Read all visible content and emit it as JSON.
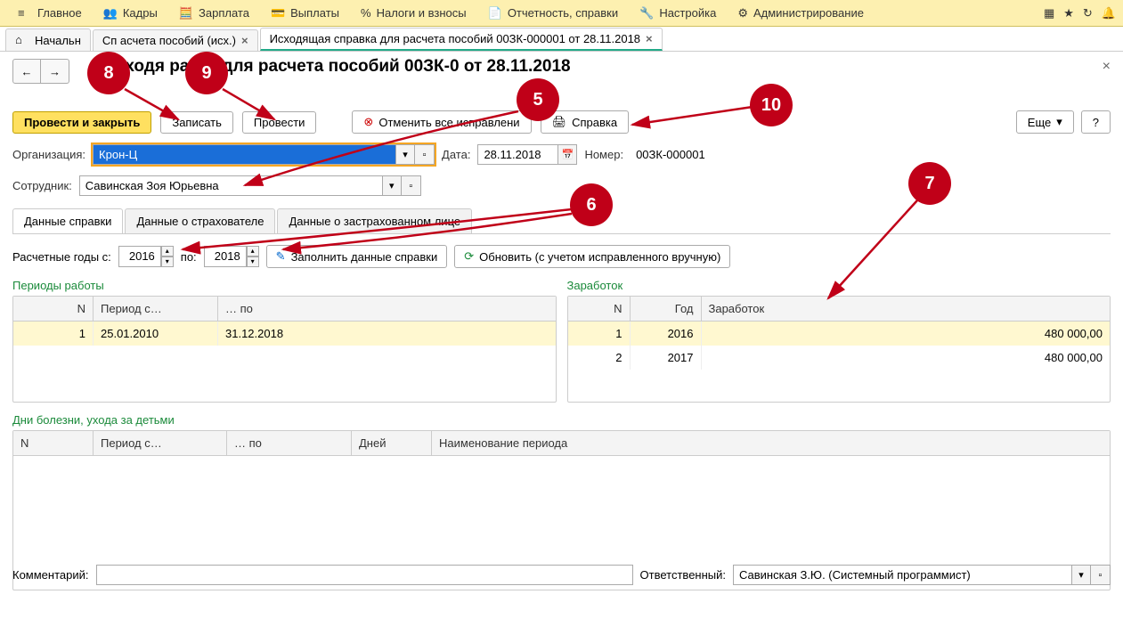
{
  "topbar": {
    "items": [
      {
        "label": "Главное"
      },
      {
        "label": "Кадры"
      },
      {
        "label": "Зарплата"
      },
      {
        "label": "Выплаты"
      },
      {
        "label": "Налоги и взносы"
      },
      {
        "label": "Отчетность, справки"
      },
      {
        "label": "Настройка"
      },
      {
        "label": "Администрирование"
      }
    ]
  },
  "tabs": {
    "t0": "Начальн",
    "t1": "Сп                 асчета пособий (исх.)",
    "t2": "Исходящая справка для расчета пособий 00ЗК-000001 от 28.11.2018"
  },
  "page_title": "сходя           равка для расчета пособий 00ЗК-0             от 28.11.2018",
  "toolbar": {
    "post_close": "Провести и закрыть",
    "write": "Записать",
    "post": "Провести",
    "cancel_fix": "Отменить все исправлени",
    "help": "Справка",
    "more": "Еще",
    "q": "?"
  },
  "form": {
    "org_label": "Организация:",
    "org_value": "Крон-Ц",
    "date_label": "Дата:",
    "date_value": "28.11.2018",
    "num_label": "Номер:",
    "num_value": "00ЗК-000001",
    "emp_label": "Сотрудник:",
    "emp_value": "Савинская Зоя Юрьевна"
  },
  "inner_tabs": {
    "a": "Данные справки",
    "b": "Данные о страхователе",
    "c": "Данные о застрахованном лице"
  },
  "years": {
    "label": "Расчетные годы с:",
    "from": "2016",
    "to_label": "по:",
    "to": "2018",
    "fill": "Заполнить данные справки",
    "refresh": "Обновить (с учетом исправленного вручную)"
  },
  "sections": {
    "periods": "Периоды работы",
    "earn": "Заработок",
    "sick": "Дни болезни, ухода за детьми"
  },
  "periods_table": {
    "h_n": "N",
    "h_from": "Период с…",
    "h_to": "… по",
    "rows": [
      {
        "n": "1",
        "from": "25.01.2010",
        "to": "31.12.2018"
      }
    ]
  },
  "earn_table": {
    "h_n": "N",
    "h_y": "Год",
    "h_e": "Заработок",
    "rows": [
      {
        "n": "1",
        "y": "2016",
        "e": "480 000,00"
      },
      {
        "n": "2",
        "y": "2017",
        "e": "480 000,00"
      }
    ]
  },
  "sick_table": {
    "h_n": "N",
    "h_from": "Период с…",
    "h_to": "… по",
    "h_days": "Дней",
    "h_name": "Наименование периода"
  },
  "footer": {
    "comment_label": "Комментарий:",
    "resp_label": "Ответственный:",
    "resp_value": "Савинская З.Ю. (Системный программист)"
  },
  "badges": {
    "b5": "5",
    "b6": "6",
    "b7": "7",
    "b8": "8",
    "b9": "9",
    "b10": "10"
  }
}
